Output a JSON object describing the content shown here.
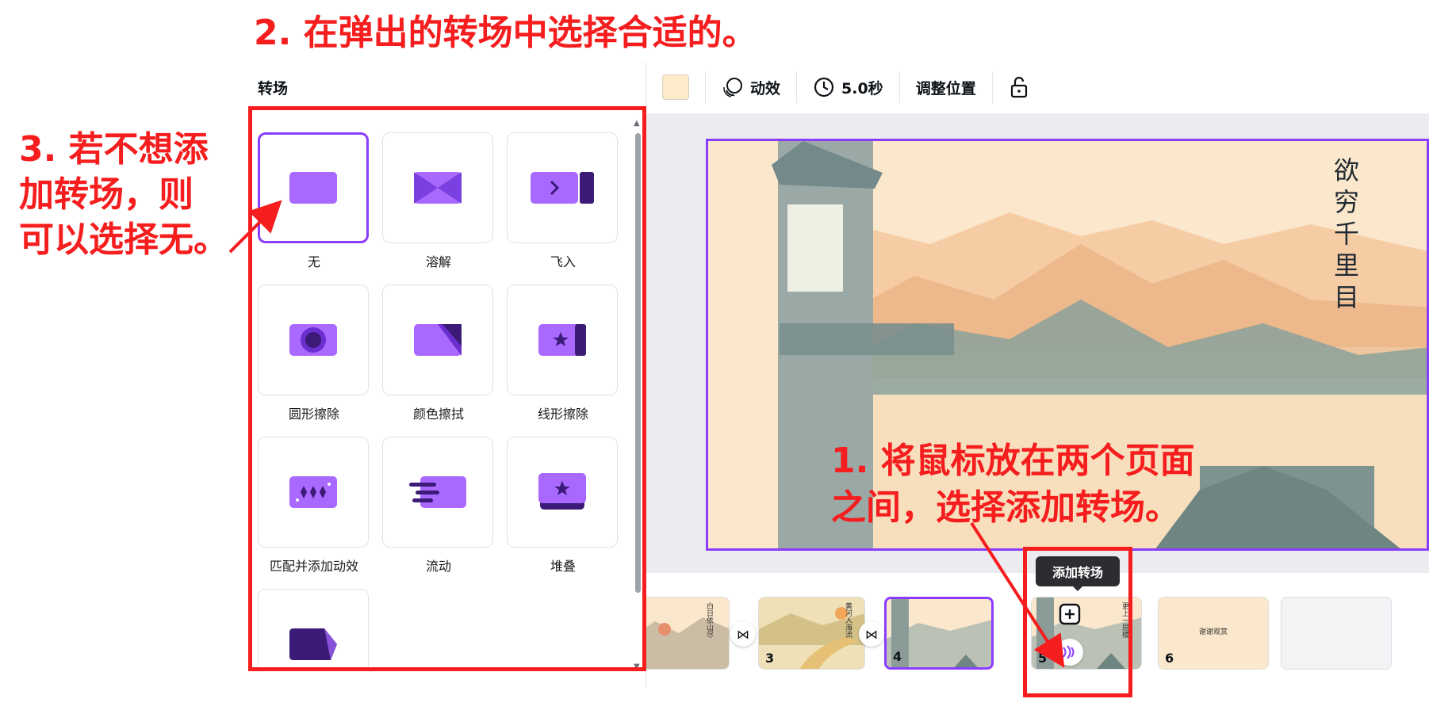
{
  "annotations": {
    "step2": "2. 在弹出的转场中选择合适的。",
    "step3_lines": [
      "3. 若不想添",
      "加转场，则",
      "可以选择无。"
    ],
    "step1_lines": [
      "1. 将鼠标放在两个页面",
      "之间，选择添加转场。"
    ]
  },
  "panel": {
    "title": "转场",
    "transitions": [
      {
        "label": "无",
        "icon": "none-transition-icon",
        "selected": true
      },
      {
        "label": "溶解",
        "icon": "dissolve-icon"
      },
      {
        "label": "飞入",
        "icon": "fly-in-icon"
      },
      {
        "label": "圆形擦除",
        "icon": "circle-wipe-icon"
      },
      {
        "label": "颜色擦拭",
        "icon": "color-wipe-icon"
      },
      {
        "label": "线形擦除",
        "icon": "line-wipe-icon"
      },
      {
        "label": "匹配并添加动效",
        "icon": "match-move-icon"
      },
      {
        "label": "流动",
        "icon": "flow-icon"
      },
      {
        "label": "堆叠",
        "icon": "stack-icon"
      },
      {
        "label": "",
        "icon": "slide-icon"
      }
    ]
  },
  "toolbar": {
    "animate_label": "动效",
    "duration_label": "5.0秒",
    "position_label": "调整位置",
    "swatch_color": "#fdebc9"
  },
  "slide": {
    "title": "欲穷千里目"
  },
  "timeline": {
    "tooltip": "添加转场",
    "pages": [
      {
        "num": "",
        "text": "白日依山尽"
      },
      {
        "num": "3",
        "text": "黄河入海流"
      },
      {
        "num": "4",
        "text": "",
        "active": true
      },
      {
        "num": "5",
        "text": "更上一层楼"
      },
      {
        "num": "6",
        "text": "谢谢观赏"
      }
    ]
  },
  "colors": {
    "accent": "#8b3dff",
    "annotation_red": "#f51d1d"
  }
}
